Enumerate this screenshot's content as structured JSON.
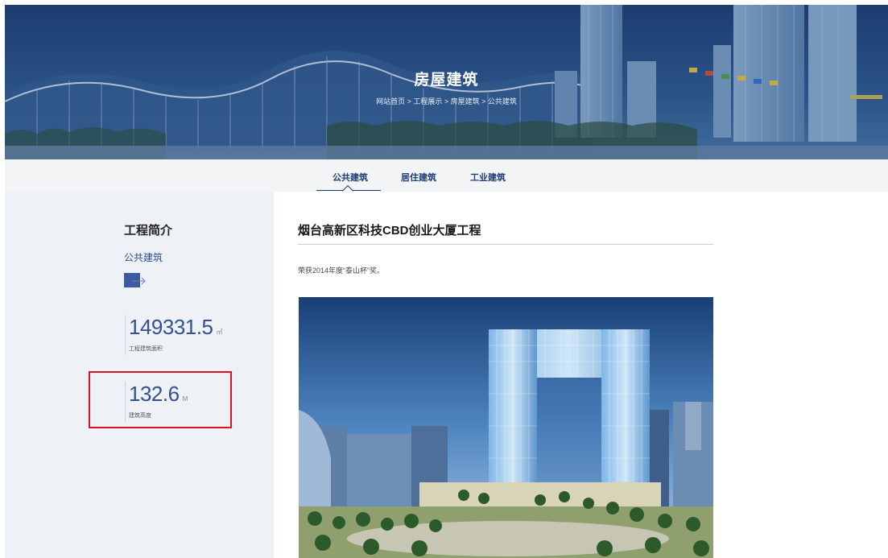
{
  "banner": {
    "title": "房屋建筑",
    "breadcrumb": "网站首页 > 工程展示 > 房屋建筑 > 公共建筑"
  },
  "tabs": [
    {
      "label": "公共建筑",
      "active": true
    },
    {
      "label": "居住建筑",
      "active": false
    },
    {
      "label": "工业建筑",
      "active": false
    }
  ],
  "sidebar": {
    "title": "工程简介",
    "category": "公共建筑",
    "arrow_icon": "arrow-right-icon",
    "stats": [
      {
        "value": "149331.5",
        "unit": "㎡",
        "label": "工程建筑面积"
      },
      {
        "value": "132.6",
        "unit": "M",
        "label": "建筑高度"
      }
    ]
  },
  "main": {
    "project_title": "烟台高新区科技CBD创业大厦工程",
    "award": "荣获2014年度“泰山杯”奖。"
  },
  "colors": {
    "accent": "#1e3c78",
    "stat_number": "#34508f",
    "highlight_box": "#e0101c",
    "sidebar_bg": "#eef2f7"
  }
}
